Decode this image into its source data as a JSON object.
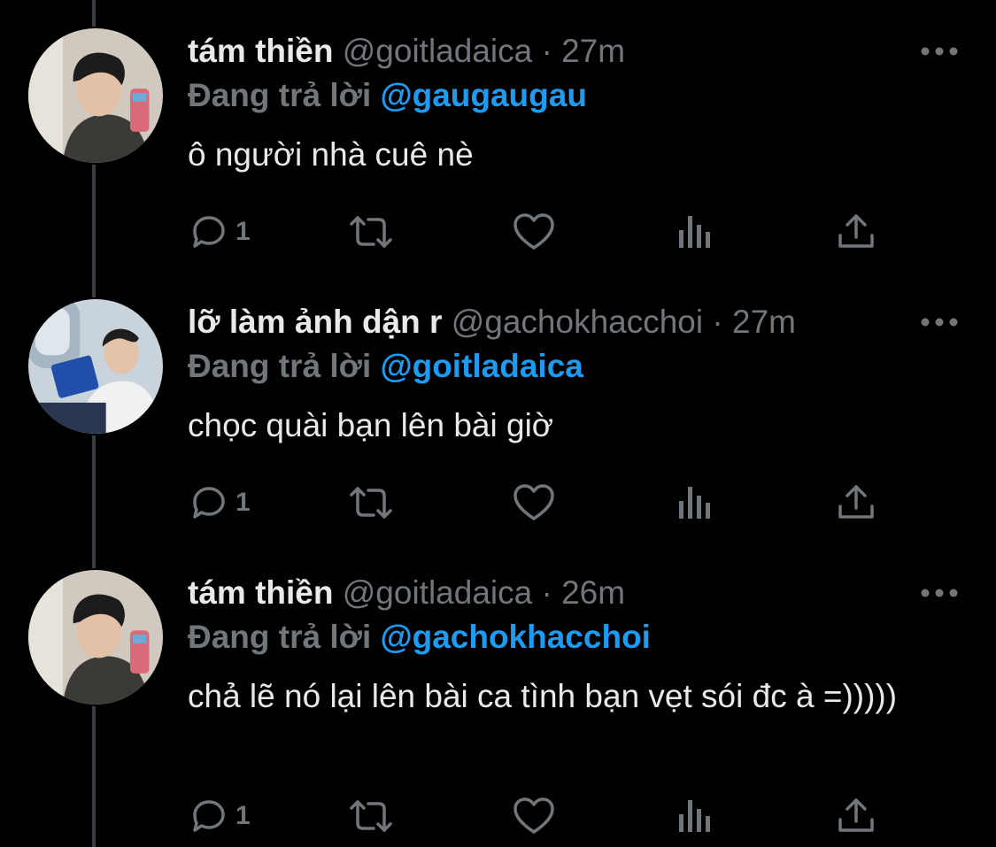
{
  "colors": {
    "background": "#000000",
    "text": "#e7e9ea",
    "muted": "#71767b",
    "accent": "#1d9bf0",
    "thread_line": "#3a3d41"
  },
  "reply_prefix": "Đang trả lời",
  "dot": "·",
  "tweets": [
    {
      "display_name": "tám thiền",
      "handle": "@goitladaica",
      "time": "27m",
      "reply_to": "@gaugaugau",
      "text": "ô người nhà cuê nè",
      "reply_count": "1",
      "avatar_icon": "avatar-photo"
    },
    {
      "display_name": "lỡ làm ảnh dận r",
      "handle": "@gachokhacchoi",
      "time": "27m",
      "reply_to": "@goitladaica",
      "text": "chọc quài bạn lên bài giờ",
      "reply_count": "1",
      "avatar_icon": "avatar-photo"
    },
    {
      "display_name": "tám thiền",
      "handle": "@goitladaica",
      "time": "26m",
      "reply_to": "@gachokhacchoi",
      "text": "chả lẽ nó lại lên bài ca tình bạn vẹt sói đc à =)))))",
      "reply_count": "1",
      "avatar_icon": "avatar-photo"
    }
  ],
  "action_icons": [
    "reply-icon",
    "retweet-icon",
    "like-icon",
    "views-icon",
    "share-icon"
  ]
}
